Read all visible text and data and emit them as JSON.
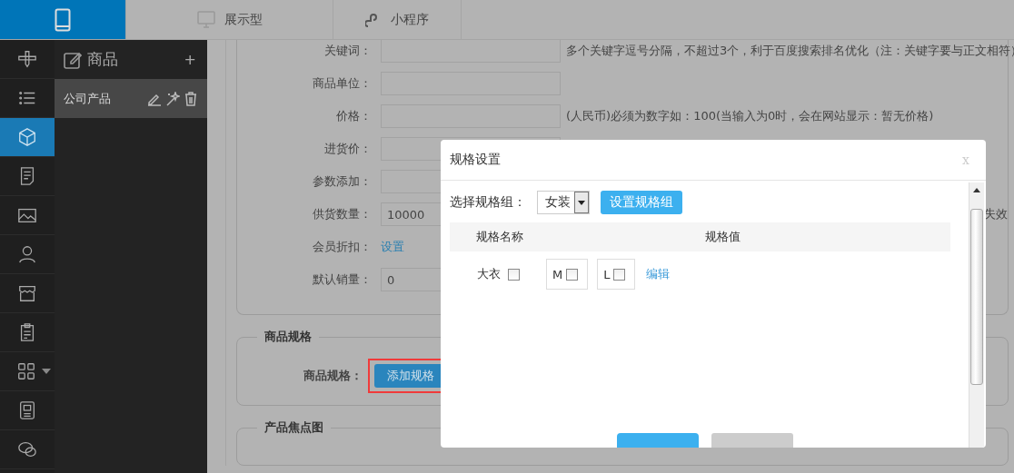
{
  "top_tabs": [
    {
      "kind": "mobile",
      "selected": true
    },
    {
      "kind": "desktop",
      "label": "展示型",
      "selected": false
    },
    {
      "kind": "mini-program",
      "label": "小程序",
      "selected": false
    }
  ],
  "nav_icons": [
    {
      "kind": "tools",
      "selected": false
    },
    {
      "kind": "list",
      "selected": false
    },
    {
      "kind": "box",
      "selected": true
    },
    {
      "kind": "document",
      "selected": false
    },
    {
      "kind": "image",
      "selected": false
    },
    {
      "kind": "user",
      "selected": false
    },
    {
      "kind": "store",
      "selected": false
    },
    {
      "kind": "clipboard",
      "selected": false
    },
    {
      "kind": "grid",
      "selected": false
    },
    {
      "kind": "picture-card",
      "selected": false
    },
    {
      "kind": "chat",
      "selected": false
    }
  ],
  "category_panel": {
    "title": "商品",
    "add": "+",
    "items": [
      {
        "label": "公司产品",
        "selected": true
      }
    ]
  },
  "form": {
    "fields": [
      {
        "kind": "input",
        "label": "关键词：",
        "hint": "多个关键字逗号分隔，不超过3个，利于百度搜索排名优化（注：关键字要与正文相符）"
      },
      {
        "kind": "input",
        "label": "商品单位："
      },
      {
        "kind": "input",
        "label": "价格：",
        "hint": "(人民币)必须为数字如：100(当输入为0时，会在网站显示：暂无价格)"
      },
      {
        "kind": "input",
        "label": "进货价："
      },
      {
        "kind": "input",
        "label": "参数添加："
      },
      {
        "kind": "input",
        "label": "供货数量：",
        "value": "10000",
        "hint_end": "失效"
      },
      {
        "kind": "link",
        "label": "会员折扣：",
        "link": "设置"
      },
      {
        "kind": "input",
        "label": "默认销量：",
        "value": "0"
      }
    ]
  },
  "sections": [
    {
      "title": "商品规格",
      "label": "商品规格：",
      "button": "添加规格",
      "highlighted": true
    },
    {
      "title": "产品焦点图"
    }
  ],
  "dialog": {
    "title": "规格设置",
    "close": "x",
    "group_label": "选择规格组：",
    "group_value": "女装",
    "set_group_button": "设置规格组",
    "columns": [
      "规格名称",
      "规格值"
    ],
    "rows": [
      {
        "name": "大衣",
        "checked": false,
        "values": [
          {
            "label": "M",
            "checked": false
          },
          {
            "label": "L",
            "checked": false
          }
        ],
        "action": "编辑"
      }
    ]
  }
}
